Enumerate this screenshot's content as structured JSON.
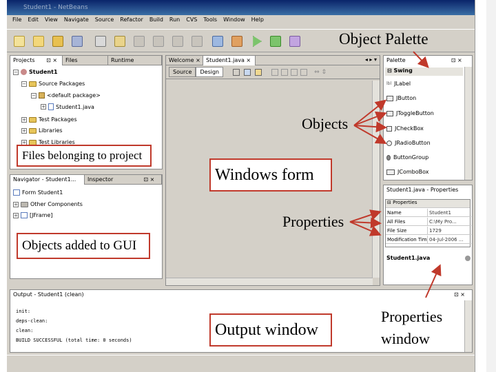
{
  "window": {
    "title": "Student1 - NetBeans"
  },
  "menu": [
    "File",
    "Edit",
    "View",
    "Navigate",
    "Source",
    "Refactor",
    "Build",
    "Run",
    "CVS",
    "Tools",
    "Window",
    "Help"
  ],
  "toolbar_icons": [
    "new-file-icon",
    "new-project-icon",
    "open-project-icon",
    "save-all-icon",
    "cut-icon",
    "copy-icon",
    "paste-icon",
    "undo-icon",
    "redo-icon",
    "find-icon",
    "build-icon",
    "clean-build-icon",
    "run-icon",
    "debug-icon",
    "profile-icon"
  ],
  "projects_panel": {
    "tabs": [
      "Projects",
      "Files",
      "Runtime"
    ],
    "tree": [
      {
        "label": "Student1",
        "bold": true
      },
      {
        "label": "Source Packages"
      },
      {
        "label": "<default package>"
      },
      {
        "label": "Student1.java"
      },
      {
        "label": "Test Packages"
      },
      {
        "label": "Libraries"
      },
      {
        "label": "Test Libraries"
      }
    ]
  },
  "navigator_panel": {
    "tabs": [
      "Navigator - Student1...",
      "Inspector"
    ],
    "tree": [
      {
        "label": "Form Student1"
      },
      {
        "label": "Other Components"
      },
      {
        "label": "[JFrame]"
      }
    ]
  },
  "editor": {
    "tabs": [
      "Welcome",
      "Student1.java"
    ],
    "modes": [
      "Source",
      "Design"
    ]
  },
  "palette": {
    "title": "Palette",
    "category": "Swing",
    "items": [
      "JLabel",
      "JButton",
      "JToggleButton",
      "JCheckBox",
      "JRadioButton",
      "ButtonGroup",
      "JComboBox"
    ]
  },
  "properties": {
    "title": "Student1.java - Properties",
    "section": "Properties",
    "rows": [
      {
        "key": "Name",
        "value": "Student1"
      },
      {
        "key": "All Files",
        "value": "C:\\My Pro..."
      },
      {
        "key": "File Size",
        "value": "1729"
      },
      {
        "key": "Modification Tim",
        "value": "04-Jul-2006 ..."
      }
    ],
    "footer": "Student1.java"
  },
  "output": {
    "title": "Output - Student1 (clean)",
    "lines": [
      "init:",
      "deps-clean:",
      "clean:",
      "BUILD SUCCESSFUL (total time: 0 seconds)"
    ]
  },
  "annotations": {
    "object_palette": "Object Palette",
    "objects": "Objects",
    "properties": "Properties",
    "properties_window": [
      "Properties",
      "window"
    ],
    "files_belonging": "Files belonging to project",
    "windows_form": "Windows form",
    "objects_added": "Objects added to GUI",
    "output_window": "Output window"
  },
  "colors": {
    "callout_border": "#c0392b",
    "arrow": "#c0392b",
    "ide_bg": "#d4d0c8"
  }
}
